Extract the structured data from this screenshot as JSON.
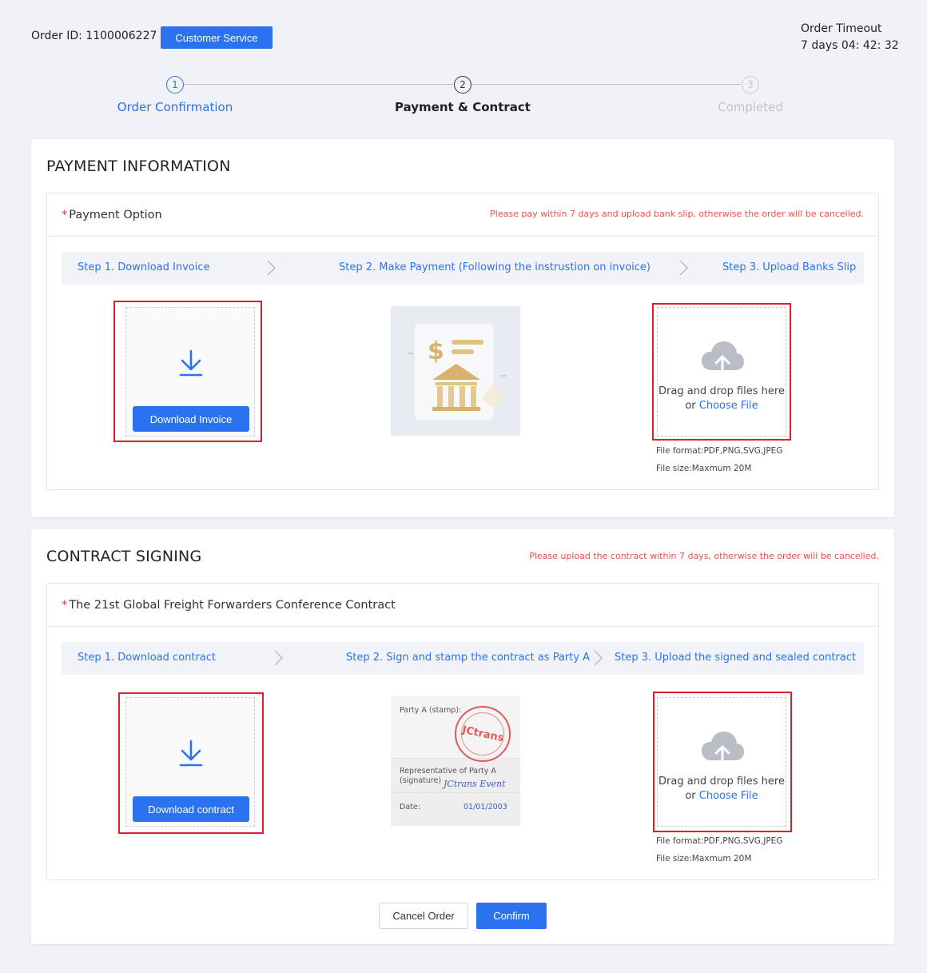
{
  "header": {
    "order_id": "Order ID: 1100006227",
    "customer_service": "Customer Service",
    "timeout_label": "Order Timeout",
    "timeout_value": "7 days 04: 42: 32"
  },
  "steps": [
    {
      "num": "1",
      "label": "Order Confirmation"
    },
    {
      "num": "2",
      "label": "Payment & Contract"
    },
    {
      "num": "3",
      "label": "Completed"
    }
  ],
  "payment": {
    "title": "PAYMENT INFORMATION",
    "option_label": "Payment Option",
    "warning": "Please pay within 7 days and upload bank slip, otherwise the order will be cancelled.",
    "step1": "Step 1. Download Invoice",
    "step2": "Step 2. Make Payment (Following the instrustion on invoice)",
    "step3": "Step 3. Upload Banks Slip",
    "download_btn": "Download Invoice",
    "upload_text": "Drag and drop files here",
    "upload_or": "or",
    "choose_file": "Choose File",
    "file_format": "File format:PDF,PNG,SVG,JPEG",
    "file_size": "File size:Maxmum 20M"
  },
  "contract": {
    "title": "CONTRACT SIGNING",
    "warning": "Please upload the contract within 7 days, otherwise the order will be cancelled.",
    "name": "The 21st Global Freight Forwarders Conference Contract",
    "step1": "Step 1. Download contract",
    "step2": "Step 2. Sign and stamp the contract as Party A",
    "step3": "Step 3. Upload the signed and sealed contract",
    "download_btn": "Download contract",
    "sample_party": "Party A (stamp):",
    "sample_stamp": "JCtrans",
    "sample_rep": "Representative of Party A",
    "sample_sig_label": "(signature)",
    "sample_signature": "JCtrans Event",
    "sample_date_label": "Date:",
    "sample_date": "01/01/2003",
    "upload_text": "Drag and drop files here",
    "upload_or": "or",
    "choose_file": "Choose File",
    "file_format": "File format:PDF,PNG,SVG,JPEG",
    "file_size": "File size:Maxmum 20M"
  },
  "footer": {
    "cancel": "Cancel Order",
    "confirm": "Confirm"
  },
  "colors": {
    "primary": "#2b72f0",
    "warning": "#e8524a",
    "highlight_frame": "#d8212d"
  }
}
